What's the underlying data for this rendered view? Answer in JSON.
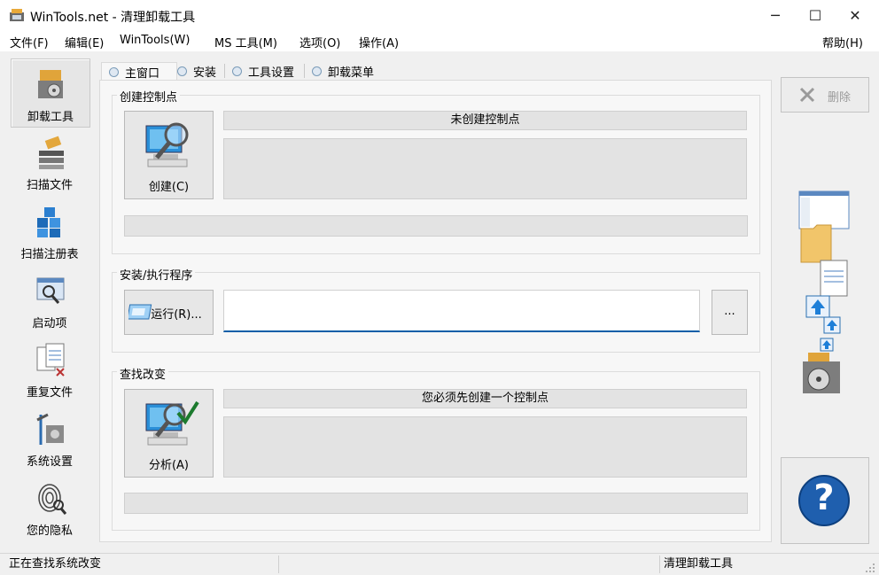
{
  "window": {
    "title": "WinTools.net - 清理卸载工具",
    "minimize_glyph": "─",
    "maximize_glyph": "☐",
    "close_glyph": "✕"
  },
  "menubar": {
    "items": [
      "文件(F)",
      "编辑(E)",
      "WinTools(W)",
      "MS 工具(M)",
      "选项(O)",
      "操作(A)"
    ],
    "help": "帮助(H)"
  },
  "sidebar": {
    "items": [
      {
        "label": "卸载工具",
        "icon": "uninstall-icon"
      },
      {
        "label": "扫描文件",
        "icon": "scan-files-icon"
      },
      {
        "label": "扫描注册表",
        "icon": "scan-registry-icon"
      },
      {
        "label": "启动项",
        "icon": "startup-icon"
      },
      {
        "label": "重复文件",
        "icon": "duplicate-files-icon"
      },
      {
        "label": "系统设置",
        "icon": "system-settings-icon"
      },
      {
        "label": "您的隐私",
        "icon": "privacy-icon"
      }
    ]
  },
  "tabs": [
    "主窗口",
    "安装",
    "工具设置",
    "卸载菜单"
  ],
  "checkpoint": {
    "group_label": "创建控制点",
    "button_label": "创建(C)",
    "status": "未创建控制点"
  },
  "install": {
    "group_label": "安装/执行程序",
    "run_label": "运行(R)...",
    "path_value": "",
    "browse_label": "..."
  },
  "changes": {
    "group_label": "查找改变",
    "button_label": "分析(A)",
    "status": "您必须先创建一个控制点"
  },
  "right": {
    "delete_label": "删除",
    "help_glyph": "?"
  },
  "statusbar": {
    "left": "正在查找系统改变",
    "right": "清理卸载工具"
  },
  "colors": {
    "accent": "#0a5fa8",
    "help_blue": "#1f5fae"
  }
}
